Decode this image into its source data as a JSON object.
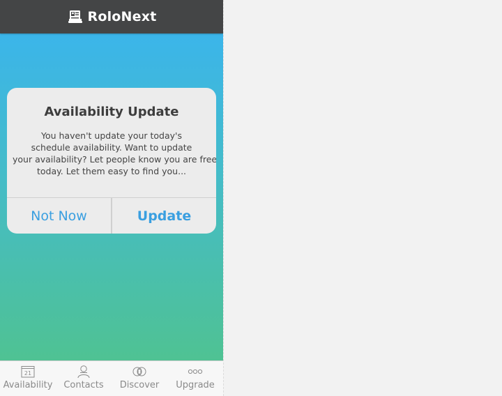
{
  "app": {
    "title": "RoloNext",
    "logo_icon": "contact-card-icon"
  },
  "dialog": {
    "title": "Availability Update",
    "message_lines": [
      "You haven't update your today's",
      "schedule availability. Want to update",
      "your availability? Let people know you are free",
      "today. Let them easy to find you..."
    ],
    "buttons": {
      "not_now": "Not Now",
      "update": "Update"
    }
  },
  "tabs": [
    {
      "label": "Availability",
      "icon": "calendar-icon",
      "icon_text": "21"
    },
    {
      "label": "Contacts",
      "icon": "person-icon"
    },
    {
      "label": "Discover",
      "icon": "discover-icon"
    },
    {
      "label": "Upgrade",
      "icon": "more-icon",
      "icon_text": "ooo"
    }
  ],
  "colors": {
    "header_bg": "#444546",
    "gradient_top": "#3bb5ea",
    "gradient_bottom": "#4fc293",
    "button_blue": "#3a9fe0",
    "tab_gray": "#8a8a8a"
  }
}
